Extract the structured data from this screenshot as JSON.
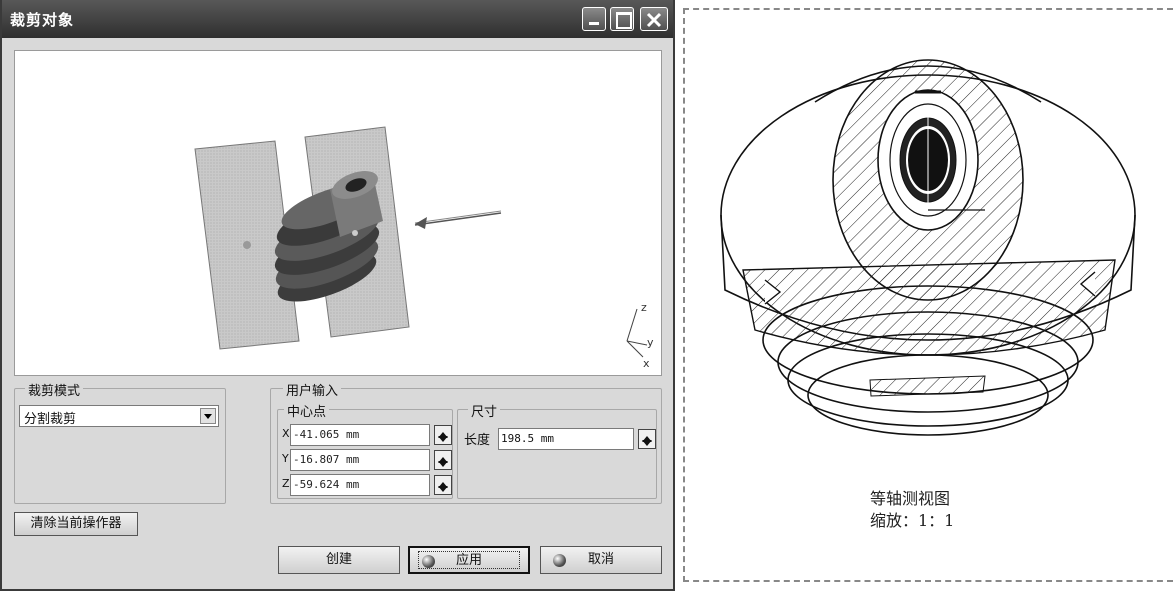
{
  "dialog": {
    "title": "裁剪对象",
    "mode_group": {
      "label": "裁剪模式",
      "selected": "分割裁剪"
    },
    "user_input": {
      "label": "用户输入",
      "center": {
        "label": "中心点",
        "fields": [
          {
            "axis": "X",
            "value": "-41.065 mm"
          },
          {
            "axis": "Y",
            "value": "-16.807 mm"
          },
          {
            "axis": "Z",
            "value": "-59.624 mm"
          }
        ]
      },
      "size": {
        "label": "尺寸",
        "length_label": "长度",
        "length_value": "198.5 mm"
      }
    },
    "clear_button": "清除当前操作器",
    "buttons": {
      "create": "创建",
      "apply": "应用",
      "cancel": "取消"
    },
    "axes": {
      "z": "z",
      "y": "y",
      "x": "x"
    }
  },
  "drawing": {
    "caption_line1": "等轴测视图",
    "caption_line2": "缩放：1：1"
  }
}
